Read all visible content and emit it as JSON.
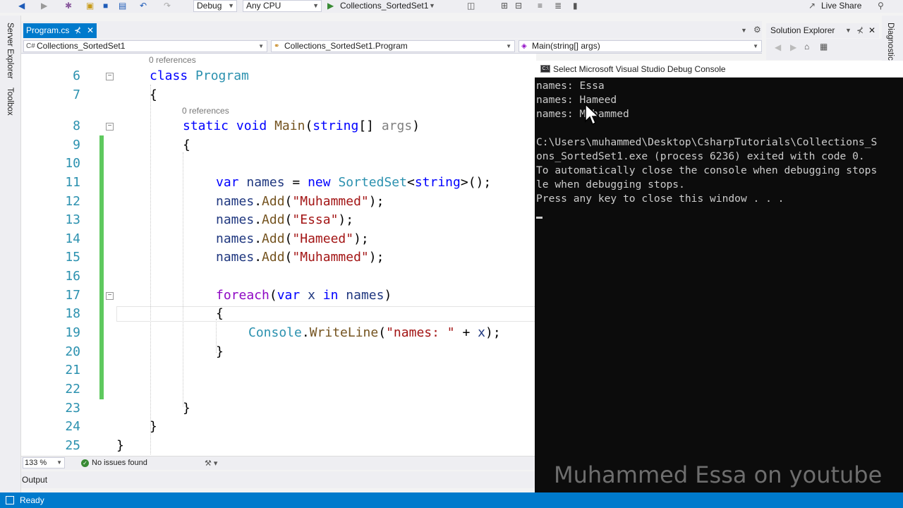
{
  "toolbar": {
    "config": "Debug",
    "platform": "Any CPU",
    "run_target": "Collections_SortedSet1",
    "live_share": "Live Share"
  },
  "side": {
    "server_explorer": "Server Explorer",
    "toolbox": "Toolbox"
  },
  "tabs": {
    "doc_tab": "Program.cs",
    "pin": "⊀",
    "close": "✕"
  },
  "nav": {
    "project": "Collections_SortedSet1",
    "class": "Collections_SortedSet1.Program",
    "member": "Main(string[] args)"
  },
  "editor": {
    "refs1": "0 references",
    "refs2": "0 references",
    "line_numbers": [
      "6",
      "7",
      "8",
      "9",
      "10",
      "11",
      "12",
      "13",
      "14",
      "15",
      "16",
      "17",
      "18",
      "19",
      "20",
      "21",
      "22",
      "23",
      "24",
      "25"
    ],
    "zoom": "133 %",
    "issues": "No issues found"
  },
  "solution_explorer": {
    "title": "Solution Explorer",
    "diagnostics": "Diagnostics"
  },
  "output": {
    "tab": "Output"
  },
  "status": {
    "ready": "Ready"
  },
  "console": {
    "title": "Select Microsoft Visual Studio Debug Console",
    "lines": [
      "names: Essa",
      "names: Hameed",
      "names: Muhammed",
      "",
      "C:\\Users\\muhammed\\Desktop\\CsharpTutorials\\Collections_S",
      "ons_SortedSet1.exe (process 6236) exited with code 0.",
      "To automatically close the console when debugging stops",
      "le when debugging stops.",
      "Press any key to close this window . . ."
    ],
    "watermark": "Muhammed Essa on youtube"
  },
  "colors": {
    "accent": "#007acc",
    "keyword": "#0000ff",
    "type": "#2b91af",
    "string": "#a31515",
    "change_bar": "#5ec95e"
  }
}
